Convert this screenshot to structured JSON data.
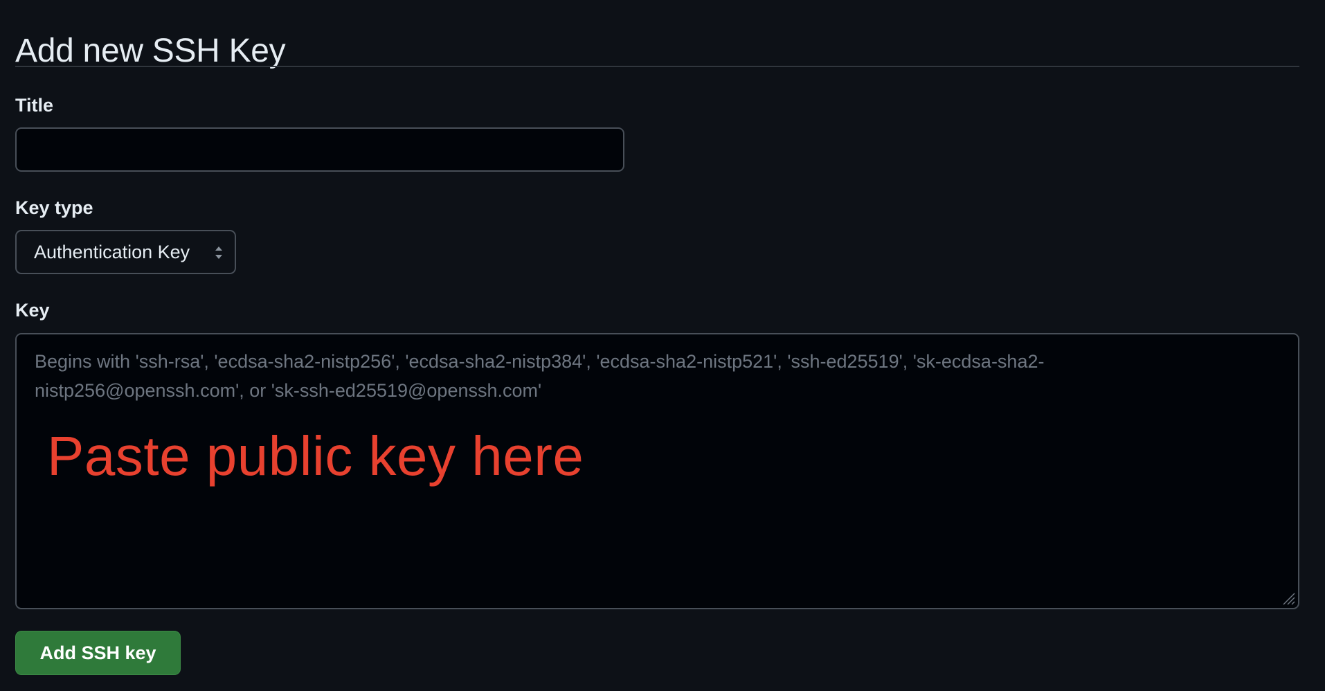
{
  "page": {
    "title": "Add new SSH Key"
  },
  "form": {
    "title_label": "Title",
    "title_value": "",
    "key_type_label": "Key type",
    "key_type_selected": "Authentication Key",
    "key_label": "Key",
    "key_placeholder": "Begins with 'ssh-rsa', 'ecdsa-sha2-nistp256', 'ecdsa-sha2-nistp384', 'ecdsa-sha2-nistp521', 'ssh-ed25519', 'sk-ecdsa-sha2-nistp256@openssh.com', or 'sk-ssh-ed25519@openssh.com'",
    "submit_label": "Add SSH key"
  },
  "annotation": {
    "text": "Paste public key here",
    "color": "#e8412f"
  },
  "icons": {
    "select_caret": "up-down-caret-icon",
    "resize": "resize-handle-icon"
  },
  "colors": {
    "background": "#0d1117",
    "input_background": "#010409",
    "border": "#484f58",
    "primary_button": "#2f7a3a"
  }
}
